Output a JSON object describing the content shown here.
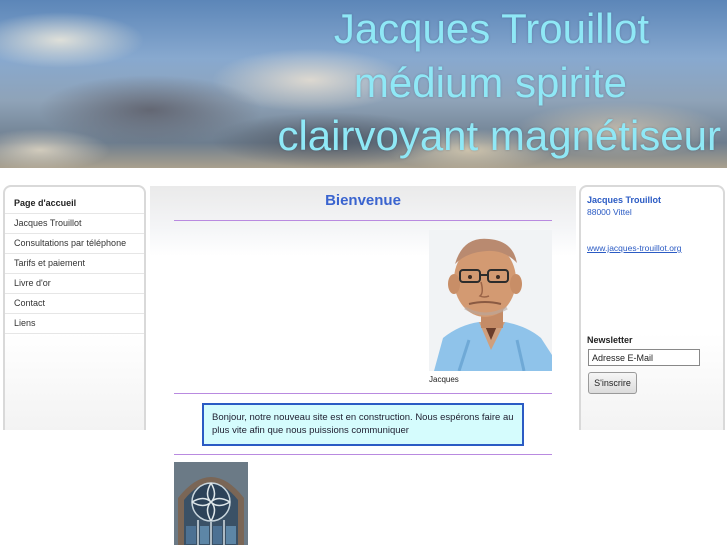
{
  "header": {
    "line1": "Jacques Trouillot",
    "line2": "médium spirite",
    "line3": "clairvoyant magnétiseur"
  },
  "nav": {
    "items": [
      {
        "label": "Page d'accueil",
        "active": true
      },
      {
        "label": "Jacques Trouillot"
      },
      {
        "label": "Consultations par téléphone"
      },
      {
        "label": "Tarifs et paiement"
      },
      {
        "label": "Livre d'or"
      },
      {
        "label": "Contact"
      },
      {
        "label": "Liens"
      }
    ]
  },
  "main": {
    "title": "Bienvenue",
    "photo_caption": "Jacques",
    "notice": "Bonjour, notre nouveau site est en construction. Nous espérons faire au plus vite afin que nous puissions communiquer"
  },
  "sidebar": {
    "name": "Jacques Trouillot",
    "city": "88000 Vittel",
    "website": "www.jacques-trouillot.org",
    "newsletter_title": "Newsletter",
    "email_value": "Adresse E-Mail",
    "subscribe_label": "S'inscrire"
  },
  "colors": {
    "header_text": "#8fe8f6",
    "accent_blue": "#2b5bc4",
    "title_blue": "#3a64cf",
    "divider_purple": "#b98ae0",
    "notice_bg": "#d5fcfd"
  }
}
